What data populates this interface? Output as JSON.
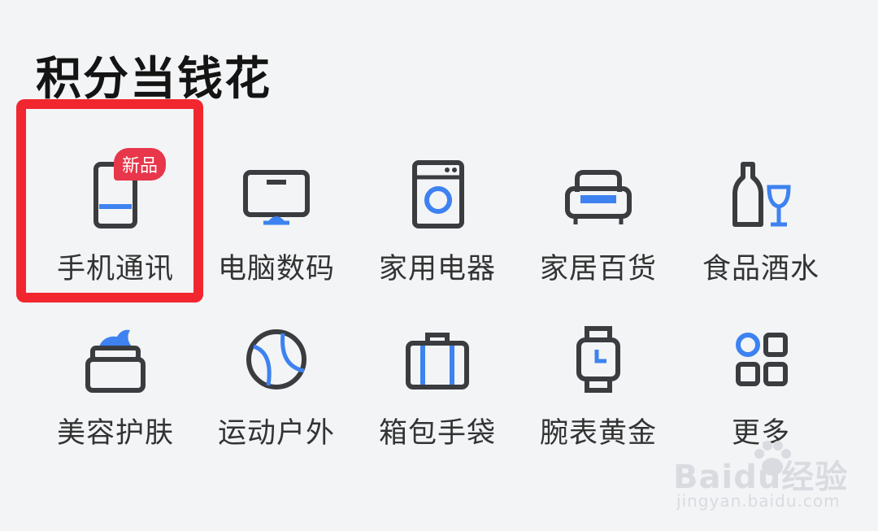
{
  "section": {
    "title": "积分当钱花"
  },
  "categories": [
    {
      "label": "手机通讯",
      "icon": "phone-icon",
      "badge": "新品"
    },
    {
      "label": "电脑数码",
      "icon": "computer-monitor-icon"
    },
    {
      "label": "家用电器",
      "icon": "washing-machine-icon"
    },
    {
      "label": "家居百货",
      "icon": "sofa-icon"
    },
    {
      "label": "食品酒水",
      "icon": "wine-bottle-glass-icon"
    },
    {
      "label": "美容护肤",
      "icon": "cream-jar-icon"
    },
    {
      "label": "运动户外",
      "icon": "sports-ball-icon"
    },
    {
      "label": "箱包手袋",
      "icon": "suitcase-icon"
    },
    {
      "label": "腕表黄金",
      "icon": "wristwatch-icon"
    },
    {
      "label": "更多",
      "icon": "more-apps-icon"
    }
  ],
  "watermark": {
    "main": "Baidu经验",
    "sub": "jingyan.baidu.com"
  },
  "colors": {
    "accent_blue": "#3d82f0",
    "icon_dark": "#3a3c40",
    "badge_red": "#e8364a",
    "highlight_red": "#f2262e"
  }
}
